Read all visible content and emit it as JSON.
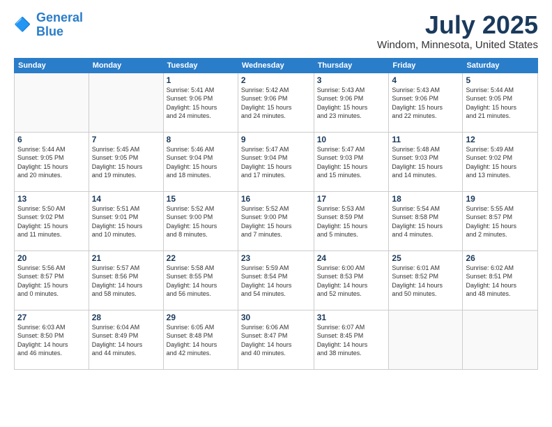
{
  "logo": {
    "line1": "General",
    "line2": "Blue"
  },
  "title": "July 2025",
  "subtitle": "Windom, Minnesota, United States",
  "days_of_week": [
    "Sunday",
    "Monday",
    "Tuesday",
    "Wednesday",
    "Thursday",
    "Friday",
    "Saturday"
  ],
  "weeks": [
    [
      {
        "day": "",
        "info": ""
      },
      {
        "day": "",
        "info": ""
      },
      {
        "day": "1",
        "info": "Sunrise: 5:41 AM\nSunset: 9:06 PM\nDaylight: 15 hours\nand 24 minutes."
      },
      {
        "day": "2",
        "info": "Sunrise: 5:42 AM\nSunset: 9:06 PM\nDaylight: 15 hours\nand 24 minutes."
      },
      {
        "day": "3",
        "info": "Sunrise: 5:43 AM\nSunset: 9:06 PM\nDaylight: 15 hours\nand 23 minutes."
      },
      {
        "day": "4",
        "info": "Sunrise: 5:43 AM\nSunset: 9:06 PM\nDaylight: 15 hours\nand 22 minutes."
      },
      {
        "day": "5",
        "info": "Sunrise: 5:44 AM\nSunset: 9:05 PM\nDaylight: 15 hours\nand 21 minutes."
      }
    ],
    [
      {
        "day": "6",
        "info": "Sunrise: 5:44 AM\nSunset: 9:05 PM\nDaylight: 15 hours\nand 20 minutes."
      },
      {
        "day": "7",
        "info": "Sunrise: 5:45 AM\nSunset: 9:05 PM\nDaylight: 15 hours\nand 19 minutes."
      },
      {
        "day": "8",
        "info": "Sunrise: 5:46 AM\nSunset: 9:04 PM\nDaylight: 15 hours\nand 18 minutes."
      },
      {
        "day": "9",
        "info": "Sunrise: 5:47 AM\nSunset: 9:04 PM\nDaylight: 15 hours\nand 17 minutes."
      },
      {
        "day": "10",
        "info": "Sunrise: 5:47 AM\nSunset: 9:03 PM\nDaylight: 15 hours\nand 15 minutes."
      },
      {
        "day": "11",
        "info": "Sunrise: 5:48 AM\nSunset: 9:03 PM\nDaylight: 15 hours\nand 14 minutes."
      },
      {
        "day": "12",
        "info": "Sunrise: 5:49 AM\nSunset: 9:02 PM\nDaylight: 15 hours\nand 13 minutes."
      }
    ],
    [
      {
        "day": "13",
        "info": "Sunrise: 5:50 AM\nSunset: 9:02 PM\nDaylight: 15 hours\nand 11 minutes."
      },
      {
        "day": "14",
        "info": "Sunrise: 5:51 AM\nSunset: 9:01 PM\nDaylight: 15 hours\nand 10 minutes."
      },
      {
        "day": "15",
        "info": "Sunrise: 5:52 AM\nSunset: 9:00 PM\nDaylight: 15 hours\nand 8 minutes."
      },
      {
        "day": "16",
        "info": "Sunrise: 5:52 AM\nSunset: 9:00 PM\nDaylight: 15 hours\nand 7 minutes."
      },
      {
        "day": "17",
        "info": "Sunrise: 5:53 AM\nSunset: 8:59 PM\nDaylight: 15 hours\nand 5 minutes."
      },
      {
        "day": "18",
        "info": "Sunrise: 5:54 AM\nSunset: 8:58 PM\nDaylight: 15 hours\nand 4 minutes."
      },
      {
        "day": "19",
        "info": "Sunrise: 5:55 AM\nSunset: 8:57 PM\nDaylight: 15 hours\nand 2 minutes."
      }
    ],
    [
      {
        "day": "20",
        "info": "Sunrise: 5:56 AM\nSunset: 8:57 PM\nDaylight: 15 hours\nand 0 minutes."
      },
      {
        "day": "21",
        "info": "Sunrise: 5:57 AM\nSunset: 8:56 PM\nDaylight: 14 hours\nand 58 minutes."
      },
      {
        "day": "22",
        "info": "Sunrise: 5:58 AM\nSunset: 8:55 PM\nDaylight: 14 hours\nand 56 minutes."
      },
      {
        "day": "23",
        "info": "Sunrise: 5:59 AM\nSunset: 8:54 PM\nDaylight: 14 hours\nand 54 minutes."
      },
      {
        "day": "24",
        "info": "Sunrise: 6:00 AM\nSunset: 8:53 PM\nDaylight: 14 hours\nand 52 minutes."
      },
      {
        "day": "25",
        "info": "Sunrise: 6:01 AM\nSunset: 8:52 PM\nDaylight: 14 hours\nand 50 minutes."
      },
      {
        "day": "26",
        "info": "Sunrise: 6:02 AM\nSunset: 8:51 PM\nDaylight: 14 hours\nand 48 minutes."
      }
    ],
    [
      {
        "day": "27",
        "info": "Sunrise: 6:03 AM\nSunset: 8:50 PM\nDaylight: 14 hours\nand 46 minutes."
      },
      {
        "day": "28",
        "info": "Sunrise: 6:04 AM\nSunset: 8:49 PM\nDaylight: 14 hours\nand 44 minutes."
      },
      {
        "day": "29",
        "info": "Sunrise: 6:05 AM\nSunset: 8:48 PM\nDaylight: 14 hours\nand 42 minutes."
      },
      {
        "day": "30",
        "info": "Sunrise: 6:06 AM\nSunset: 8:47 PM\nDaylight: 14 hours\nand 40 minutes."
      },
      {
        "day": "31",
        "info": "Sunrise: 6:07 AM\nSunset: 8:45 PM\nDaylight: 14 hours\nand 38 minutes."
      },
      {
        "day": "",
        "info": ""
      },
      {
        "day": "",
        "info": ""
      }
    ]
  ]
}
